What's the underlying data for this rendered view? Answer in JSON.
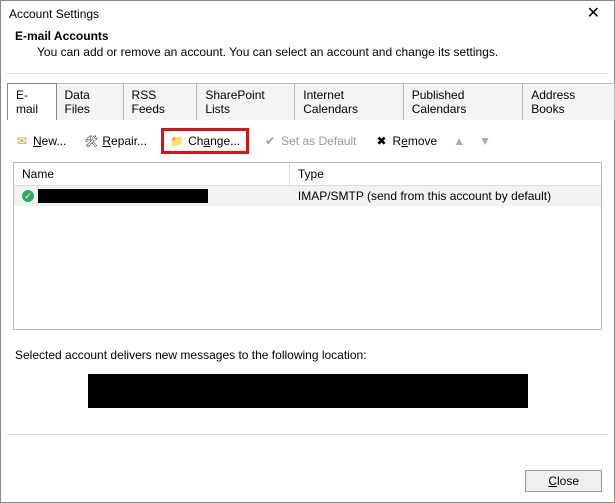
{
  "window": {
    "title": "Account Settings"
  },
  "header": {
    "title": "E-mail Accounts",
    "subtitle": "You can add or remove an account. You can select an account and change its settings."
  },
  "tabs": [
    {
      "label": "E-mail",
      "active": true
    },
    {
      "label": "Data Files"
    },
    {
      "label": "RSS Feeds"
    },
    {
      "label": "SharePoint Lists"
    },
    {
      "label": "Internet Calendars"
    },
    {
      "label": "Published Calendars"
    },
    {
      "label": "Address Books"
    }
  ],
  "toolbar": {
    "new": "New...",
    "repair": "Repair...",
    "change": "Change...",
    "setdefault": "Set as Default",
    "remove": "Remove"
  },
  "columns": {
    "name": "Name",
    "type": "Type"
  },
  "rows": [
    {
      "name": "████████████",
      "type": "IMAP/SMTP (send from this account by default)",
      "default": true
    }
  ],
  "location_label": "Selected account delivers new messages to the following location:",
  "location_value": "███████████████████████████████",
  "footer": {
    "close": "Close"
  }
}
